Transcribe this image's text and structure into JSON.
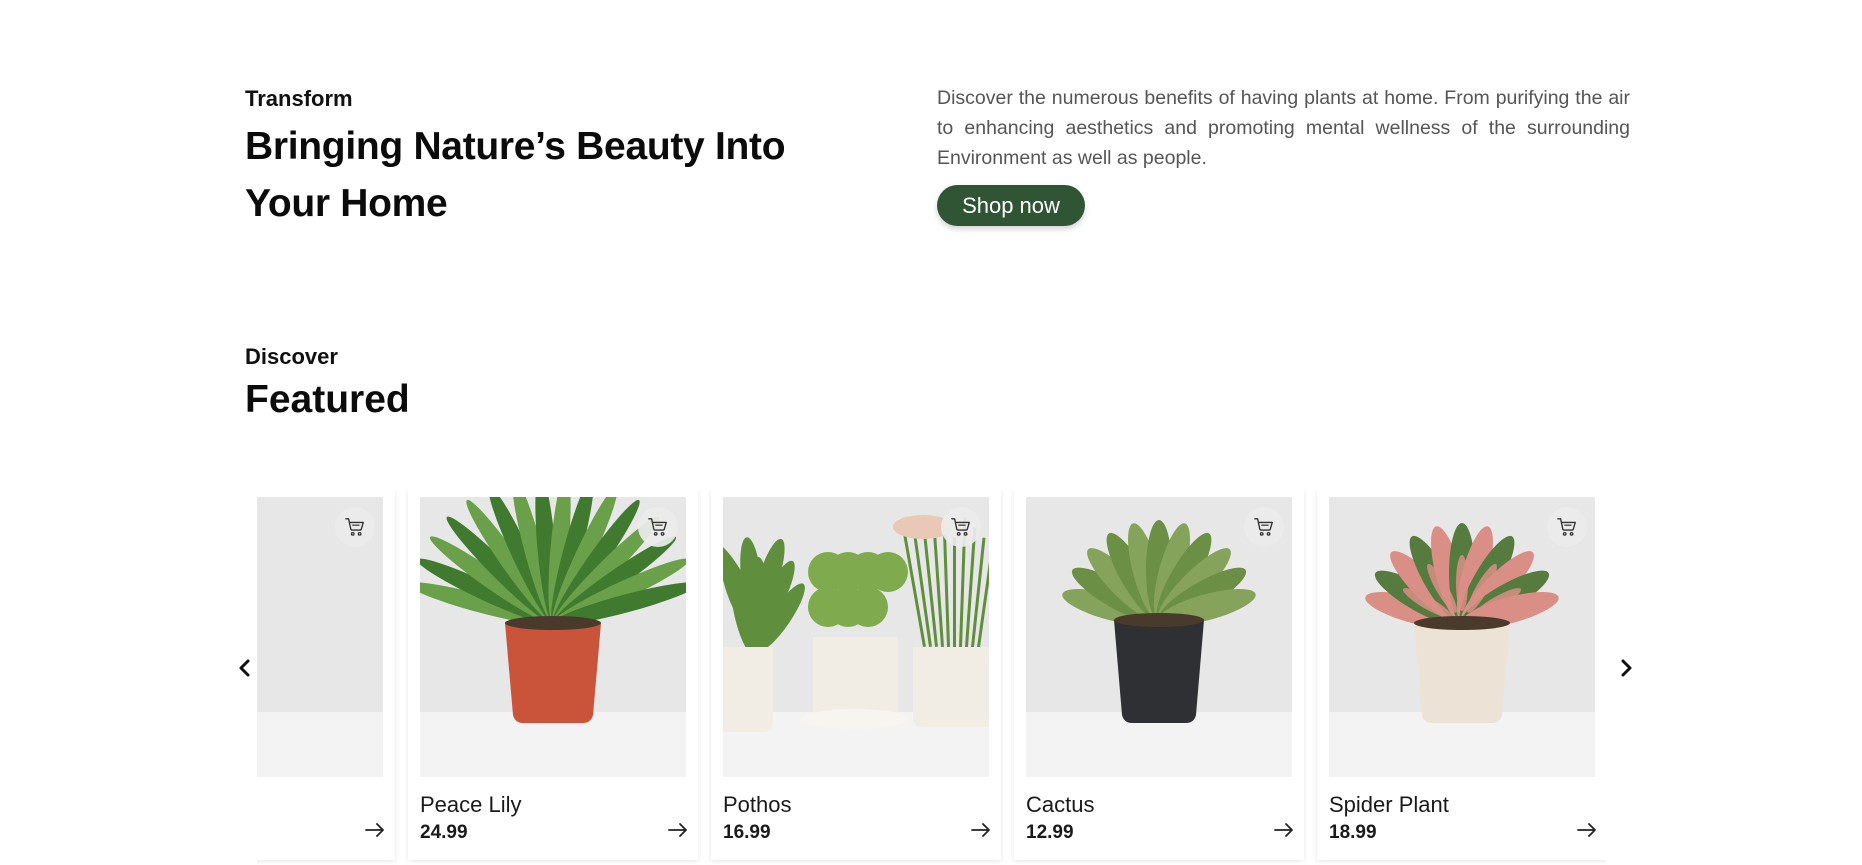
{
  "hero": {
    "eyebrow": "Transform",
    "title": "Bringing Nature’s Beauty Into Your Home",
    "description": "Discover the numerous benefits of having plants at home. From purifying the air to enhancing aesthetics and promoting mental wellness of the surrounding Environment as well as people.",
    "cta_label": "Shop now"
  },
  "featured": {
    "eyebrow": "Discover",
    "title": "Featured",
    "products": [
      {
        "name": "",
        "price": "",
        "pot_color": "#e6dccf",
        "leaf_color": "#4f7a3f",
        "accent": "#d98f86"
      },
      {
        "name": "Peace Lily",
        "price": "24.99",
        "pot_color": "#c9543a",
        "leaf_color": "#3f7a2e",
        "accent": "#6aa04a"
      },
      {
        "name": "Pothos",
        "price": "16.99",
        "pot_color": "#f1ede4",
        "leaf_color": "#5f8f3c",
        "accent": "#7faa4d"
      },
      {
        "name": "Cactus",
        "price": "12.99",
        "pot_color": "#2e3033",
        "leaf_color": "#6b8f45",
        "accent": "#86a35b"
      },
      {
        "name": "Spider Plant",
        "price": "18.99",
        "pot_color": "#ece3d6",
        "leaf_color": "#557b3f",
        "accent": "#d98f86"
      }
    ]
  },
  "icons": {
    "cart": "cart-icon",
    "arrow": "arrow-right-icon",
    "prev": "chevron-left-icon",
    "next": "chevron-right-icon"
  },
  "colors": {
    "accent": "#2f5535",
    "text": "#0f0f0f",
    "muted": "#555555"
  }
}
